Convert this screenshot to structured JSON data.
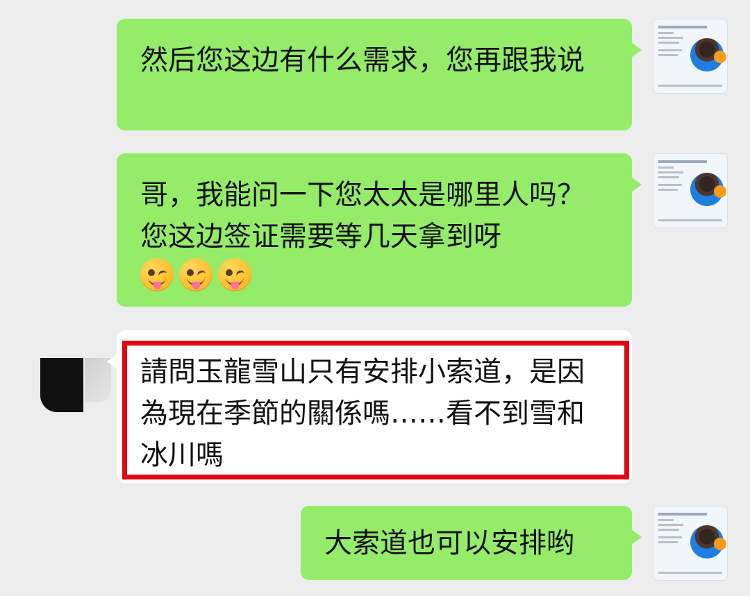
{
  "chat": {
    "messages": [
      {
        "sender": "agent",
        "text": "然后您这边有什么需求，您再跟我说",
        "emojis": []
      },
      {
        "sender": "agent",
        "text": "哥，我能问一下您太太是哪里人吗？您这边签证需要等几天拿到呀",
        "emojis": [
          "winking-tongue-emoji",
          "winking-tongue-emoji",
          "winking-tongue-emoji"
        ]
      },
      {
        "sender": "customer",
        "text": "請問玉龍雪山只有安排小索道，是因為現在季節的關係嗎……看不到雪和冰川嗎",
        "highlighted": true
      },
      {
        "sender": "agent",
        "text": "大索道也可以安排哟",
        "emojis": []
      }
    ]
  },
  "colors": {
    "sent_bubble": "#95ec69",
    "received_bubble": "#ffffff",
    "highlight_border": "#e30613",
    "background": "#ededed"
  }
}
